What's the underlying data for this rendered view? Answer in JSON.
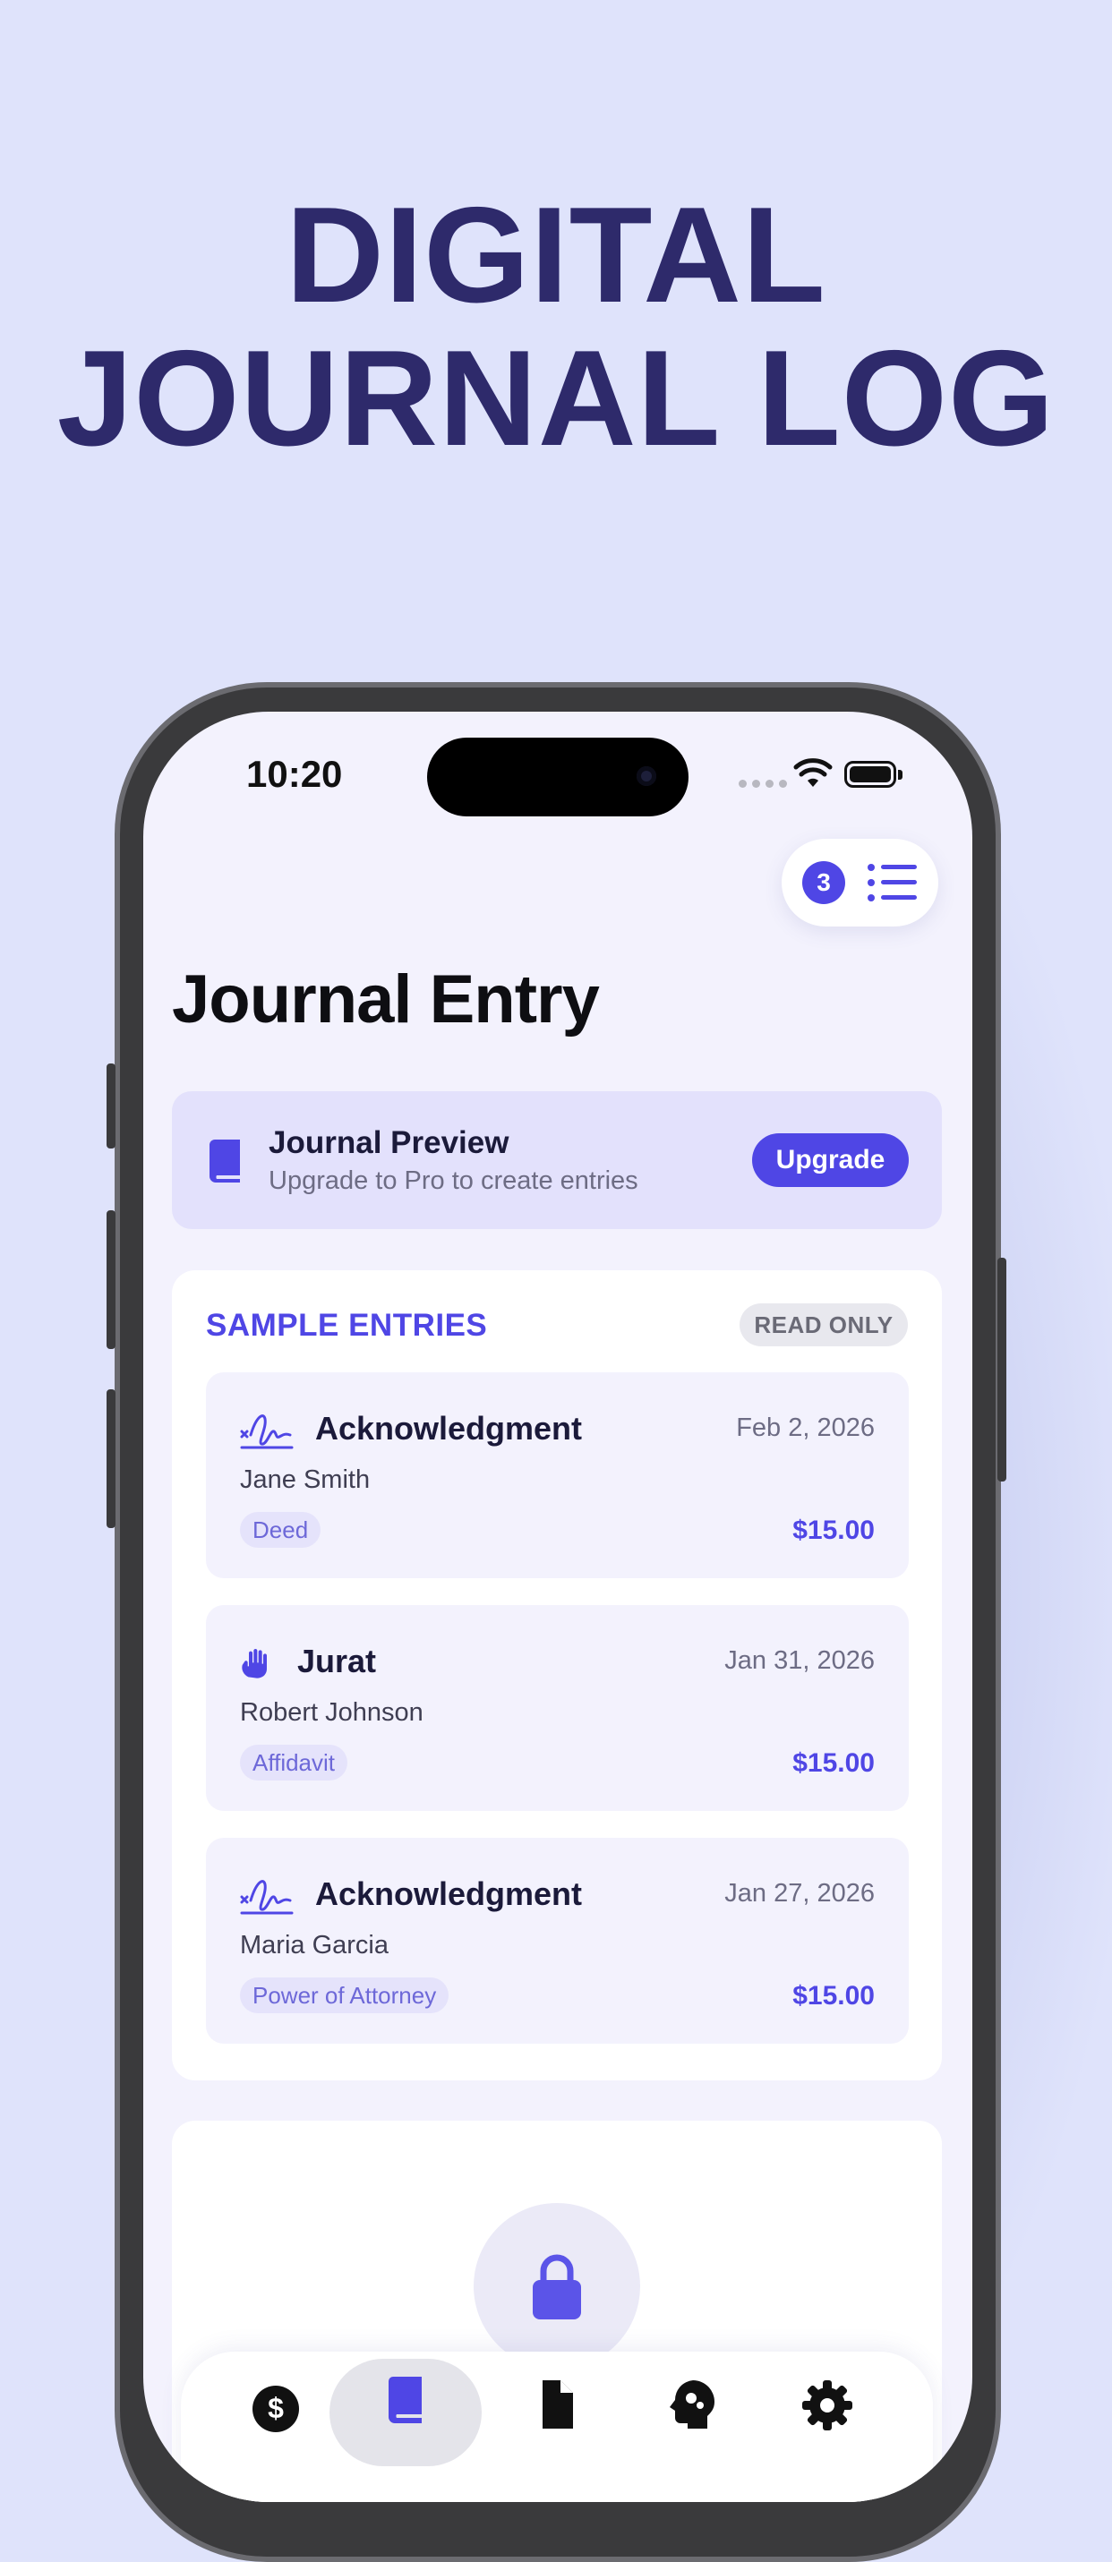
{
  "hero": {
    "line1": "DIGITAL",
    "line2": "JOURNAL LOG"
  },
  "status_bar": {
    "time": "10:20"
  },
  "queue": {
    "count": "3"
  },
  "page_title": "Journal Entry",
  "preview": {
    "title": "Journal Preview",
    "subtitle": "Upgrade to Pro to create entries",
    "button": "Upgrade"
  },
  "entries_section": {
    "title": "SAMPLE ENTRIES",
    "badge": "READ ONLY",
    "items": [
      {
        "icon": "signature-icon",
        "type": "Acknowledgment",
        "date": "Feb 2, 2026",
        "client": "Jane Smith",
        "tag": "Deed",
        "fee": "$15.00"
      },
      {
        "icon": "raised-hand-icon",
        "type": "Jurat",
        "date": "Jan 31, 2026",
        "client": "Robert Johnson",
        "tag": "Affidavit",
        "fee": "$15.00"
      },
      {
        "icon": "signature-icon",
        "type": "Acknowledgment",
        "date": "Jan 27, 2026",
        "client": "Maria Garcia",
        "tag": "Power of Attorney",
        "fee": "$15.00"
      }
    ]
  },
  "tabs": [
    {
      "name": "fees",
      "icon": "dollar-icon"
    },
    {
      "name": "journal",
      "icon": "book-icon",
      "active": true
    },
    {
      "name": "documents",
      "icon": "document-icon"
    },
    {
      "name": "assistant",
      "icon": "brain-icon"
    },
    {
      "name": "settings",
      "icon": "gear-icon"
    }
  ],
  "colors": {
    "accent": "#4f46e5",
    "background": "#dfe3fb",
    "hero_text": "#2e2a6b",
    "screen_bg": "#f3f2fd"
  }
}
